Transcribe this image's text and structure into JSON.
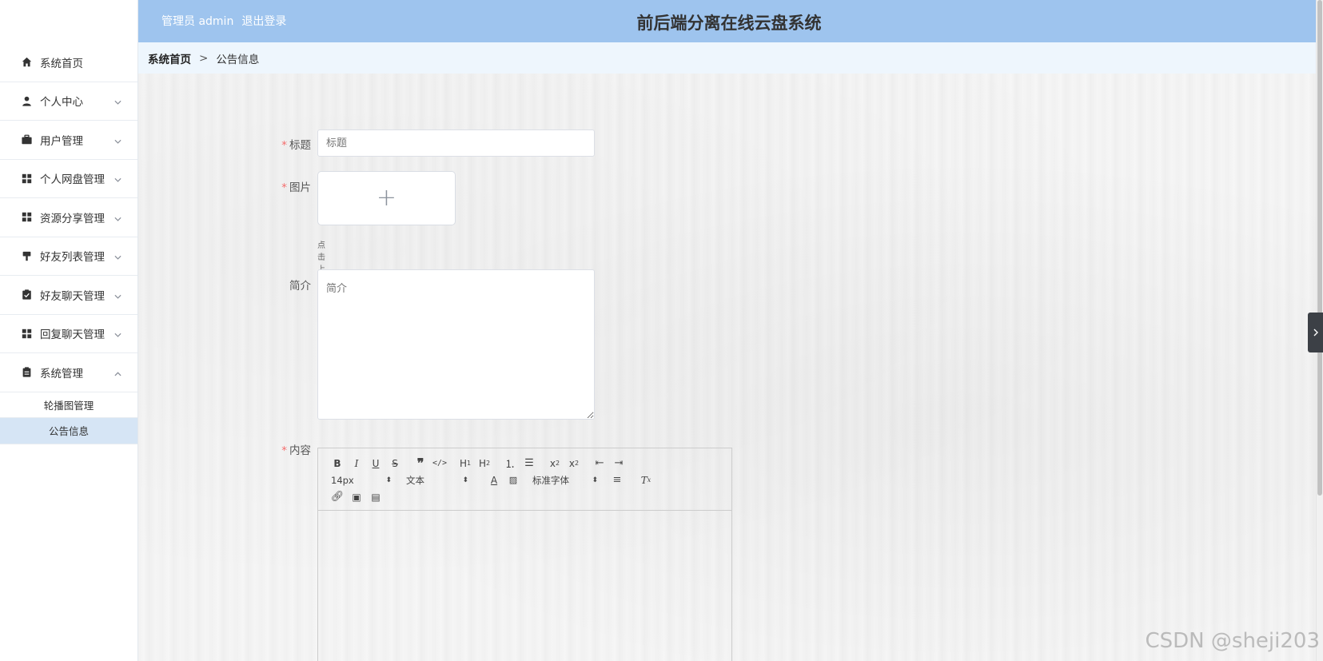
{
  "header": {
    "user_prefix": "管理员 admin",
    "logout": "退出登录",
    "title": "前后端分离在线云盘系统"
  },
  "breadcrumb": {
    "home": "系统首页",
    "separator": ">",
    "current": "公告信息"
  },
  "sidebar": {
    "items": [
      {
        "label": "系统首页",
        "icon": "home-icon"
      },
      {
        "label": "个人中心",
        "icon": "user-icon"
      },
      {
        "label": "用户管理",
        "icon": "briefcase-icon"
      },
      {
        "label": "个人网盘管理",
        "icon": "grid-icon"
      },
      {
        "label": "资源分享管理",
        "icon": "grid-icon"
      },
      {
        "label": "好友列表管理",
        "icon": "brush-icon"
      },
      {
        "label": "好友聊天管理",
        "icon": "clipboard-check-icon"
      },
      {
        "label": "回复聊天管理",
        "icon": "grid-icon"
      },
      {
        "label": "系统管理",
        "icon": "clipboard-icon"
      }
    ],
    "sub_items": [
      "轮播图管理",
      "公告信息"
    ]
  },
  "form": {
    "title_label": "标题",
    "title_placeholder": "标题",
    "image_label": "图片",
    "upload_hint": "点击上传图片",
    "intro_label": "简介",
    "intro_placeholder": "简介",
    "content_label": "内容"
  },
  "editor": {
    "font_size": "14px",
    "header_select": "文本",
    "font_family": "标准字体"
  },
  "watermark": "CSDN @sheji203",
  "colors": {
    "header_bg": "#9ec4ee",
    "breadcrumb_bg": "#eef6fd",
    "active_sub_bg": "#d6e5f5",
    "required": "#f56c6c"
  }
}
